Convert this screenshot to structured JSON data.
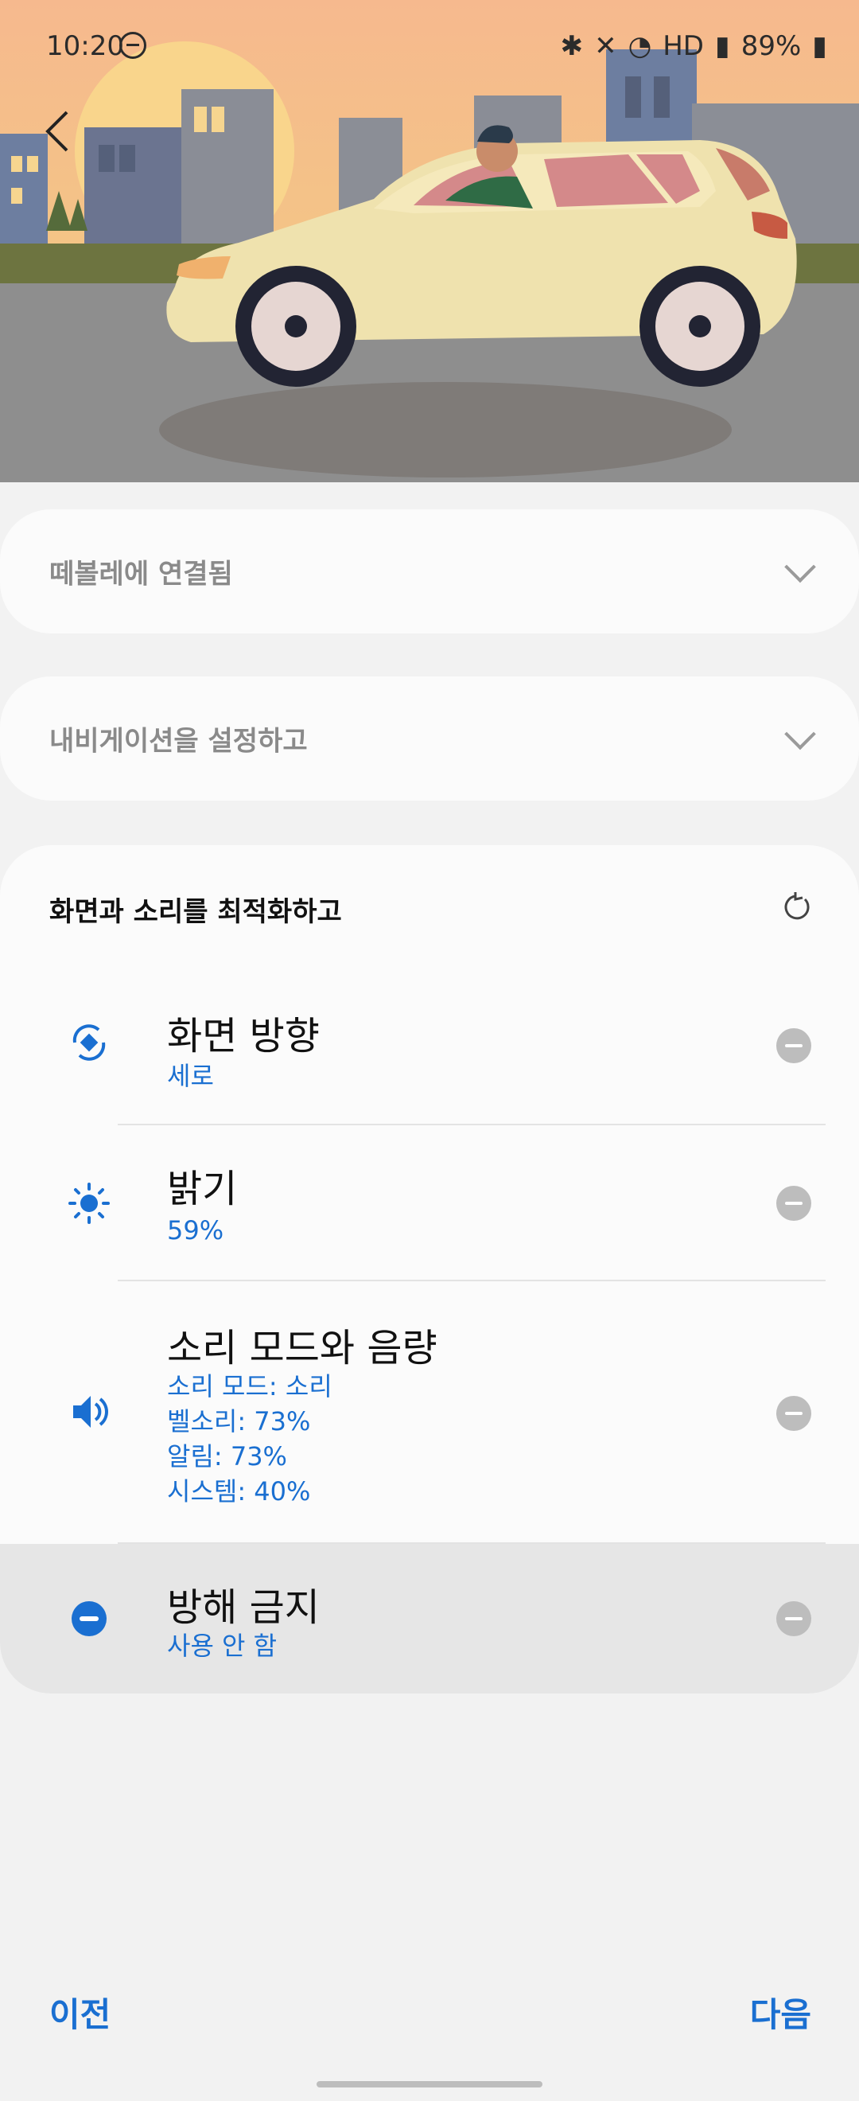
{
  "status_bar": {
    "time": "10:20",
    "battery": "89%",
    "network_label": "HD"
  },
  "sections": {
    "collapsed_1": {
      "label": "떼볼레에 연결됨"
    },
    "collapsed_2": {
      "label": "내비게이션을 설정하고"
    }
  },
  "main_card": {
    "title": "화면과 소리를 최적화하고",
    "items": [
      {
        "title": "화면 방향",
        "subtitle": "세로"
      },
      {
        "title": "밝기",
        "subtitle": "59%"
      },
      {
        "title": "소리 모드와 음량",
        "subtitle": "소리 모드: 소리",
        "subtitle_2": "벨소리: 73%",
        "subtitle_3": "알림: 73%",
        "subtitle_4": "시스템: 40%"
      },
      {
        "title": "방해 금지",
        "subtitle": "사용 안 함"
      }
    ]
  },
  "footer": {
    "prev": "이전",
    "next": "다음"
  },
  "colors": {
    "accent": "#1a6fd1",
    "sky_top": "#f6b98e",
    "ground": "#8e8e8e"
  }
}
